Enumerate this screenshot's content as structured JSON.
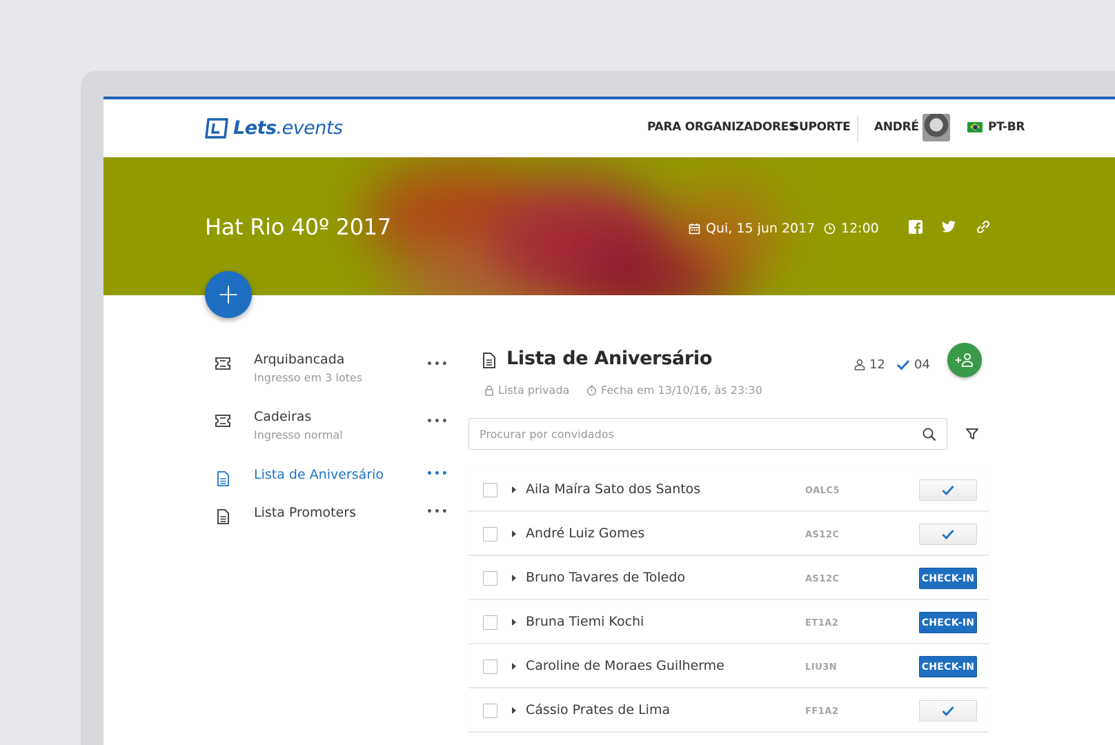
{
  "brand": {
    "name_bold": "Lets",
    "name_rest": ".events"
  },
  "nav": {
    "organizers": "PARA ORGANIZADORES",
    "support": "SUPORTE",
    "user": "ANDRÉ",
    "language": "PT-BR"
  },
  "event": {
    "title": "Hat Rio 40º 2017",
    "date": "Qui, 15 jun 2017",
    "time": "12:00",
    "add_label": "+"
  },
  "sidebar": {
    "items": [
      {
        "title": "Arquibancada",
        "subtitle": "Ingresso em 3 lotes",
        "icon": "ticket-icon",
        "menu": "•••"
      },
      {
        "title": "Cadeiras",
        "subtitle": "Ingresso normal",
        "icon": "ticket-icon",
        "menu": "•••"
      },
      {
        "title": "Lista de Aniversário",
        "subtitle": "",
        "icon": "document-icon",
        "menu": "•••",
        "active": true
      },
      {
        "title": "Lista Promoters",
        "subtitle": "",
        "icon": "document-icon",
        "menu": "•••"
      }
    ]
  },
  "list": {
    "title": "Lista de Aniversário",
    "guest_count": "12",
    "checked_count": "04",
    "privacy": "Lista privada",
    "closes": "Fecha em 13/10/16, às 23:30",
    "search_placeholder": "Procurar por convidados"
  },
  "guests": [
    {
      "name": "Aila Maíra Sato dos Santos",
      "code": "OALC5",
      "status": "checked"
    },
    {
      "name": "André Luiz Gomes",
      "code": "AS12C",
      "status": "checked"
    },
    {
      "name": "Bruno Tavares de Toledo",
      "code": "AS12C",
      "status": "checkin",
      "action": "CHECK-IN"
    },
    {
      "name": "Bruna Tiemi Kochi",
      "code": "ET1A2",
      "status": "checkin",
      "action": "CHECK-IN"
    },
    {
      "name": "Caroline de Moraes Guilherme",
      "code": "LIU3N",
      "status": "checkin",
      "action": "CHECK-IN"
    },
    {
      "name": "Cássio Prates de Lima",
      "code": "FF1A2",
      "status": "checked"
    }
  ],
  "colors": {
    "accent": "#1e6fc1",
    "banner": "#919b00",
    "success": "#3a9a47"
  }
}
